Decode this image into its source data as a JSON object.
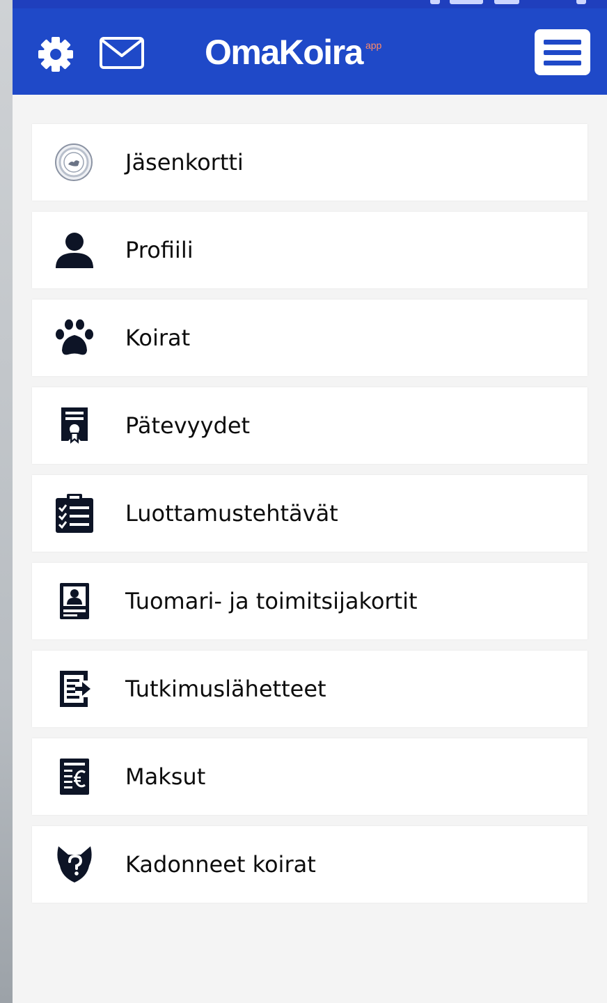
{
  "header": {
    "brand_name": "OmaKoira",
    "brand_sup": "app",
    "settings_icon": "gear-icon",
    "mail_icon": "mail-icon",
    "menu_icon": "hamburger-menu-icon"
  },
  "colors": {
    "header_bg": "#1f49c8",
    "accent_sup": "#ff8a66",
    "icon": "#0d1426",
    "page_bg": "#f4f4f4"
  },
  "menu": {
    "items": [
      {
        "label": "Jäsenkortti",
        "icon": "membership-badge-icon"
      },
      {
        "label": "Profiili",
        "icon": "user-icon"
      },
      {
        "label": "Koirat",
        "icon": "paw-icon"
      },
      {
        "label": "Pätevyydet",
        "icon": "certificate-icon"
      },
      {
        "label": "Luottamustehtävät",
        "icon": "clipboard-checklist-icon"
      },
      {
        "label": "Tuomari- ja toimitsijakortit",
        "icon": "id-card-icon"
      },
      {
        "label": "Tutkimuslähetteet",
        "icon": "document-export-icon"
      },
      {
        "label": "Maksut",
        "icon": "invoice-euro-icon"
      },
      {
        "label": "Kadonneet koirat",
        "icon": "dog-question-icon"
      }
    ]
  }
}
